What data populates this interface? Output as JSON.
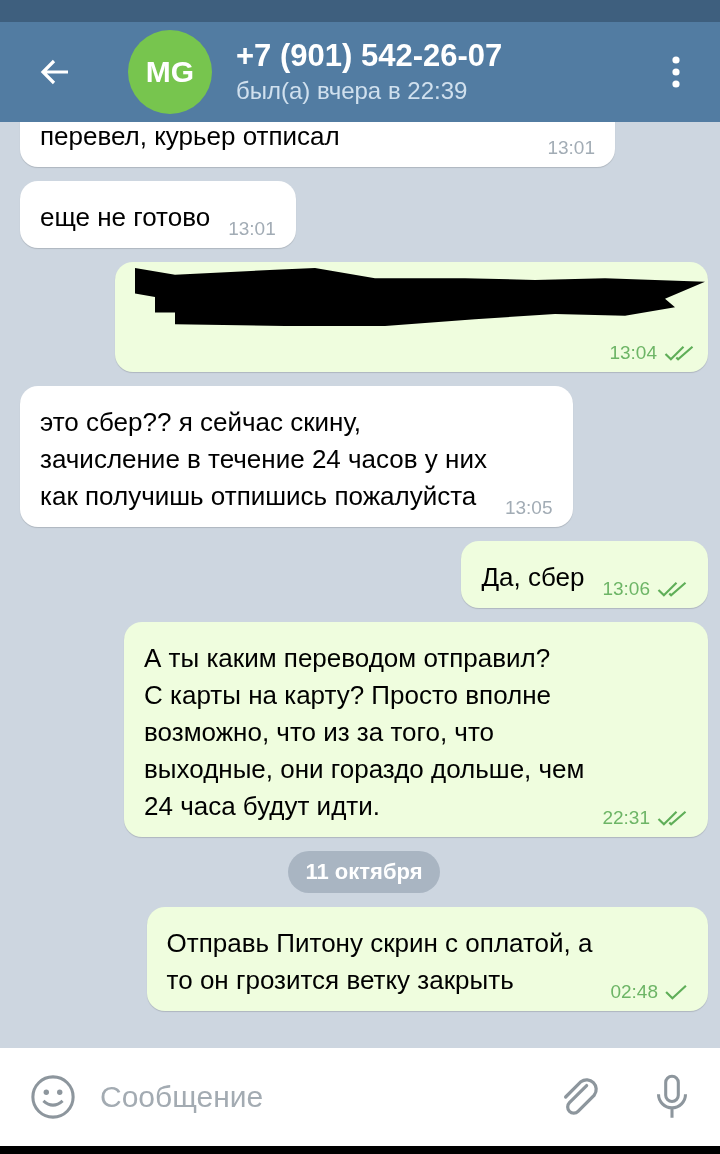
{
  "header": {
    "avatar_initials": "MG",
    "title": "+7 (901) 542-26-07",
    "status": "был(а) вчера в 22:39"
  },
  "messages": [
    {
      "kind": "message",
      "outgoing": false,
      "lines": [
        "перевел, курьер отписал"
      ],
      "time": "13:01"
    },
    {
      "kind": "message",
      "outgoing": false,
      "lines": [
        "еще не готово"
      ],
      "time": "13:01"
    },
    {
      "kind": "redacted",
      "outgoing": true,
      "time": "13:04",
      "read": true
    },
    {
      "kind": "message",
      "outgoing": false,
      "lines": [
        "это сбер?? я сейчас скину,",
        "зачисление в течение 24 часов у них",
        "как получишь отпишись пожалуйста"
      ],
      "time": "13:05"
    },
    {
      "kind": "message",
      "outgoing": true,
      "lines": [
        "Да, сбер"
      ],
      "time": "13:06",
      "read": true
    },
    {
      "kind": "message",
      "outgoing": true,
      "lines": [
        "А ты каким переводом отправил?",
        "С карты на карту? Просто вполне",
        "возможно, что из за того, что",
        "выходные, они гораздо дольше, чем",
        "24 часа будут идти."
      ],
      "time": "22:31",
      "read": true
    },
    {
      "kind": "date",
      "label": "11 октября"
    },
    {
      "kind": "message",
      "outgoing": true,
      "lines": [
        "Отправь Питону скрин с оплатой, а",
        "то он грозится ветку закрыть"
      ],
      "time": "02:48",
      "read": false
    }
  ],
  "composer": {
    "placeholder": "Сообщение"
  }
}
